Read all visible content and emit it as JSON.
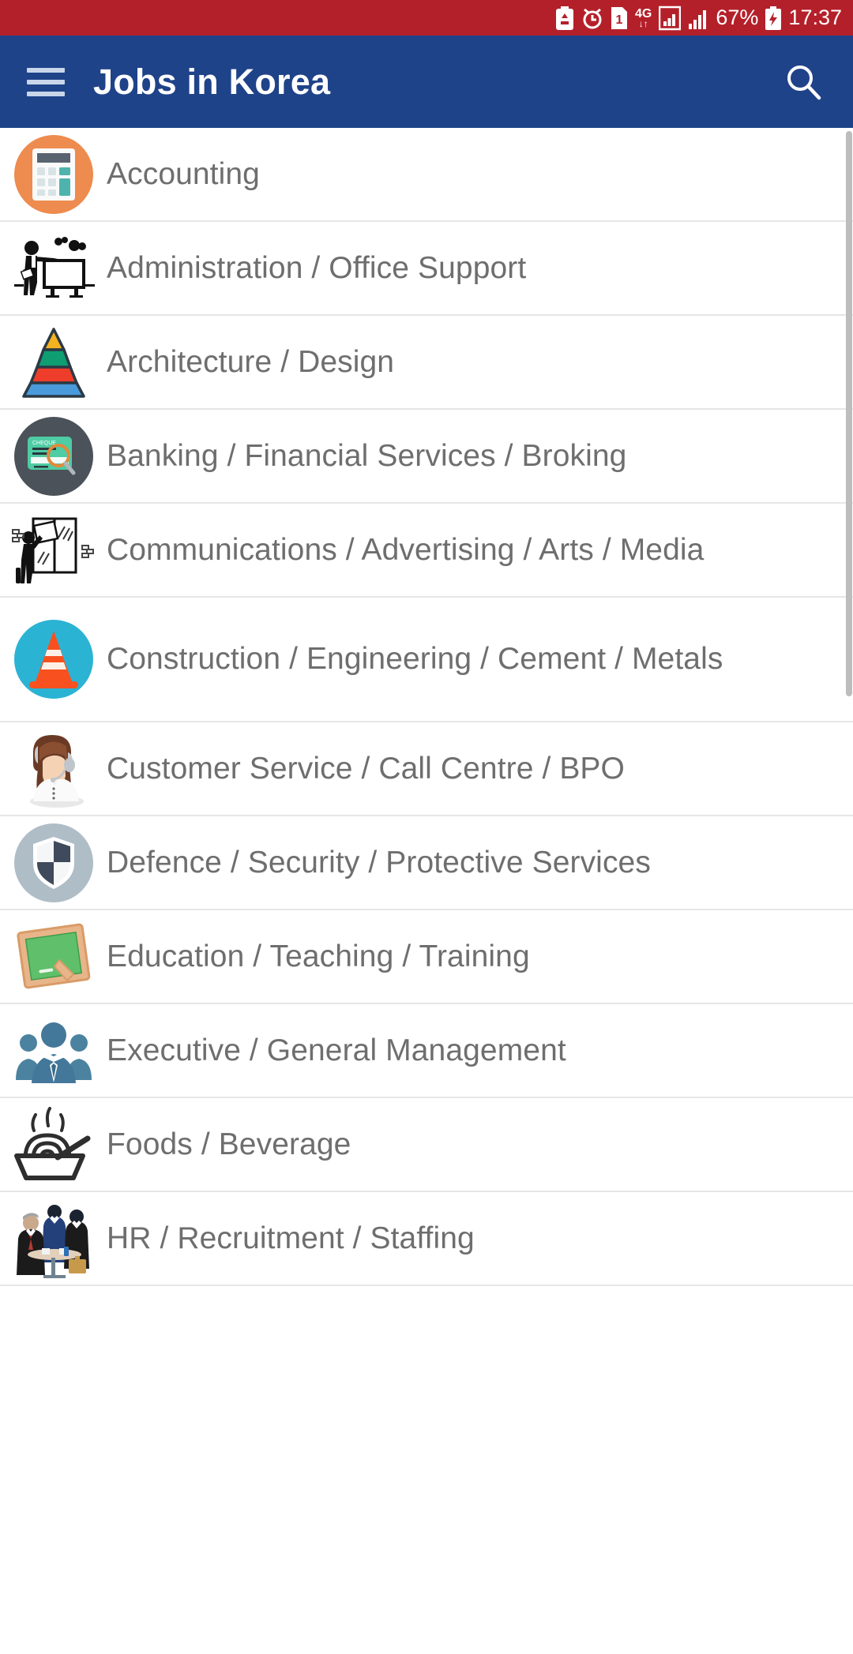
{
  "status_bar": {
    "background_color": "#B4202A",
    "icons": [
      "battery-recycle-icon",
      "alarm-icon",
      "sim1-icon",
      "4g-data-icon",
      "signal-bars-sim1-icon",
      "signal-bars-sim2-icon"
    ],
    "sim_label": "1",
    "network_label": "4G",
    "battery_percent": "67%",
    "battery_state_icon": "battery-charging-icon",
    "clock": "17:37"
  },
  "app_bar": {
    "background_color": "#1F4389",
    "menu_icon": "hamburger-menu-icon",
    "title": "Jobs in Korea",
    "search_icon": "search-icon"
  },
  "list": {
    "items": [
      {
        "label": "Accounting",
        "icon": "calculator-icon",
        "icon_style": "circle-orange"
      },
      {
        "label": "Administration / Office Support",
        "icon": "presenter-whiteboard-icon",
        "icon_style": "flat"
      },
      {
        "label": "Architecture / Design",
        "icon": "pyramid-chart-icon",
        "icon_style": "flat"
      },
      {
        "label": "Banking / Financial Services / Broking",
        "icon": "cheque-magnifier-icon",
        "icon_style": "circle-slate"
      },
      {
        "label": "Communications / Advertising / Arts / Media",
        "icon": "poster-billboard-icon",
        "icon_style": "flat"
      },
      {
        "label": "Construction / Engineering / Cement / Metals",
        "icon": "traffic-cone-icon",
        "icon_style": "circle-cyan"
      },
      {
        "label": "Customer Service / Call Centre / BPO",
        "icon": "headset-operator-icon",
        "icon_style": "flat"
      },
      {
        "label": "Defence / Security / Protective Services",
        "icon": "shield-icon",
        "icon_style": "circle-grayblue"
      },
      {
        "label": "Education / Teaching / Training",
        "icon": "chalkboard-icon",
        "icon_style": "flat"
      },
      {
        "label": "Executive / General Management",
        "icon": "business-team-icon",
        "icon_style": "flat"
      },
      {
        "label": "Foods / Beverage",
        "icon": "noodle-bowl-icon",
        "icon_style": "flat"
      },
      {
        "label": "HR / Recruitment / Staffing",
        "icon": "interview-panel-icon",
        "icon_style": "flat"
      }
    ]
  },
  "scrollbar": {
    "visible": true,
    "thumb_color": "#BDBDBD"
  },
  "colors": {
    "status_bar": "#B4202A",
    "app_bar": "#1F4389",
    "row_text": "#6E6E6E",
    "divider": "#E6E6E6",
    "accent_orange": "#EE8B4E",
    "accent_cyan": "#2BB3D4",
    "accent_slate": "#4B5259",
    "accent_grayblue": "#AFBDC7"
  }
}
